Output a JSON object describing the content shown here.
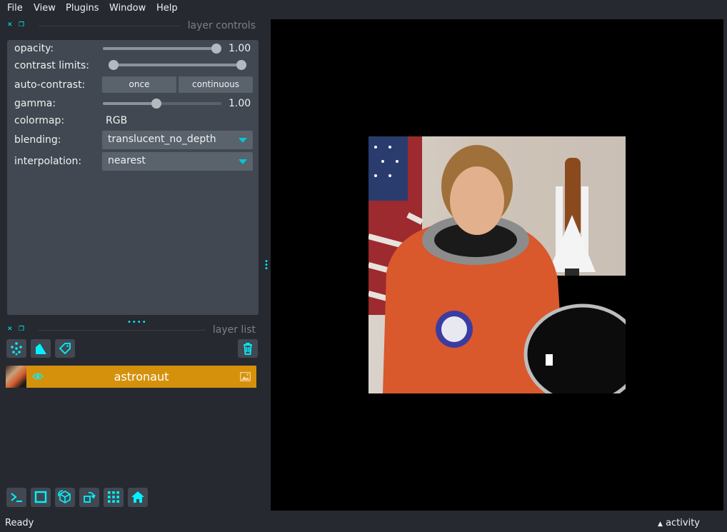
{
  "menu": {
    "items": [
      "File",
      "View",
      "Plugins",
      "Window",
      "Help"
    ]
  },
  "layer_controls": {
    "title": "layer controls",
    "opacity": {
      "label": "opacity:",
      "value_text": "1.00",
      "fraction": 1.0
    },
    "contrast_limits": {
      "label": "contrast limits:",
      "low_fraction": 0.0,
      "high_fraction": 1.0
    },
    "auto_contrast": {
      "label": "auto-contrast:",
      "once": "once",
      "continuous": "continuous"
    },
    "gamma": {
      "label": "gamma:",
      "value_text": "1.00",
      "fraction": 0.45
    },
    "colormap": {
      "label": "colormap:",
      "value": "RGB"
    },
    "blending": {
      "label": "blending:",
      "value": "translucent_no_depth"
    },
    "interpolation": {
      "label": "interpolation:",
      "value": "nearest"
    }
  },
  "layer_list": {
    "title": "layer list",
    "layers": [
      {
        "name": "astronaut"
      }
    ]
  },
  "status": {
    "text": "Ready",
    "activity": "activity"
  },
  "colors": {
    "accent": "#00f2ff",
    "layer_selected": "#d6910c",
    "panel": "#414851",
    "background": "#262930"
  }
}
